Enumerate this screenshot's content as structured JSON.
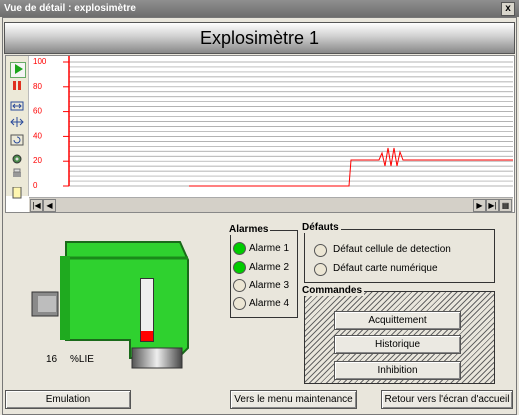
{
  "window": {
    "title": "Vue de détail : explosimètre",
    "close_label": "x"
  },
  "header": {
    "title": "Explosimètre 1"
  },
  "trend": {
    "y_ticks": [
      "100",
      "80",
      "60",
      "40",
      "20",
      "0"
    ],
    "line_color": "#ff0000",
    "grid_color": "#9a9a9a"
  },
  "toolbar": {
    "icons": [
      "play-icon",
      "pause-icon",
      "zoom-in-icon",
      "fit-icon",
      "undo-icon",
      "settings-icon",
      "print-icon",
      "legend-icon"
    ]
  },
  "detector": {
    "value": "16",
    "unit": "%LIE",
    "level_fraction": 0.16
  },
  "alarms": {
    "title": "Alarmes",
    "items": [
      {
        "label": "Alarme 1",
        "state": "on",
        "color": "#00cc00"
      },
      {
        "label": "Alarme 2",
        "state": "on",
        "color": "#00cc00"
      },
      {
        "label": "Alarme 3",
        "state": "off",
        "color": "#ece6d4"
      },
      {
        "label": "Alarme 4",
        "state": "off",
        "color": "#ece6d4"
      }
    ]
  },
  "defauts": {
    "title": "Défauts",
    "items": [
      {
        "label": "Défaut cellule de detection",
        "color": "#ece6d4"
      },
      {
        "label": "Défaut carte numérique",
        "color": "#ece6d4"
      }
    ]
  },
  "commandes": {
    "title": "Commandes",
    "buttons": [
      "Acquittement",
      "Historique",
      "Inhibition"
    ]
  },
  "bottom": {
    "emulation": "Emulation",
    "maintenance": "Vers le menu maintenance",
    "home": "Retour vers l'écran d'accueil"
  }
}
